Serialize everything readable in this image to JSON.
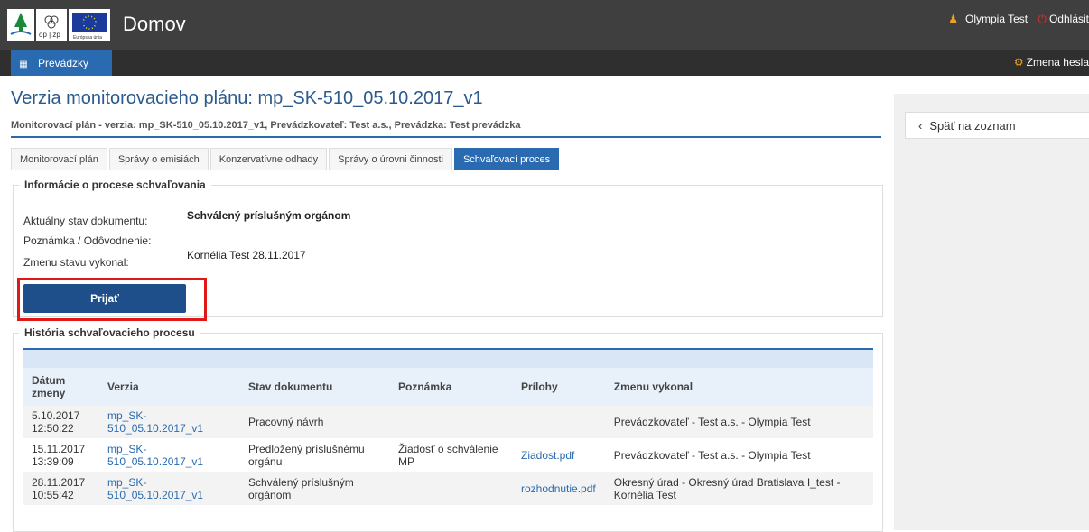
{
  "header": {
    "title": "Domov",
    "logos": [
      "op | žp",
      "Európska únia"
    ],
    "user_name": "Olympia Test",
    "logout": "Odhlásit",
    "change_password": "Zmena hesla"
  },
  "nav": {
    "item": "Prevádzky"
  },
  "page": {
    "title": "Verzia monitorovacieho plánu: mp_SK-510_05.10.2017_v1",
    "subtitle": "Monitorovací plán - verzia: mp_SK-510_05.10.2017_v1, Prevádzkovateľ: Test a.s., Prevádzka: Test prevádzka"
  },
  "tabs": [
    "Monitorovací plán",
    "Správy o emisiách",
    "Konzervatívne odhady",
    "Správy o úrovni činnosti",
    "Schvaľovací proces"
  ],
  "info": {
    "legend": "Informácie o procese schvaľovania",
    "state_label": "Aktuálny stav dokumentu:",
    "state_value": "Schválený príslušným orgánom",
    "note_label": "Poznámka / Odôvodnenie:",
    "changed_label": "Zmenu stavu vykonal:",
    "changed_value": "Kornélia Test 28.11.2017",
    "accept_button": "Prijať"
  },
  "history": {
    "legend": "História schvaľovacieho procesu",
    "columns": [
      "Dátum zmeny",
      "Verzia",
      "Stav dokumentu",
      "Poznámka",
      "Prílohy",
      "Zmenu vykonal"
    ],
    "rows": [
      [
        "5.10.2017 12:50:22",
        "mp_SK-510_05.10.2017_v1",
        "Pracovný návrh",
        "",
        "",
        "Prevádzkovateľ - Test a.s. - Olympia Test"
      ],
      [
        "15.11.2017 13:39:09",
        "mp_SK-510_05.10.2017_v1",
        "Predložený príslušnému orgánu",
        "Žiadosť o schválenie MP",
        "Ziadost.pdf",
        "Prevádzkovateľ - Test a.s. - Olympia Test"
      ],
      [
        "28.11.2017 10:55:42",
        "mp_SK-510_05.10.2017_v1",
        "Schválený príslušným orgánom",
        "",
        "rozhodnutie.pdf",
        "Okresný úrad - Okresný úrad Bratislava I_test - Kornélia Test"
      ]
    ]
  },
  "sidebar": {
    "back": "Späť na zoznam"
  }
}
